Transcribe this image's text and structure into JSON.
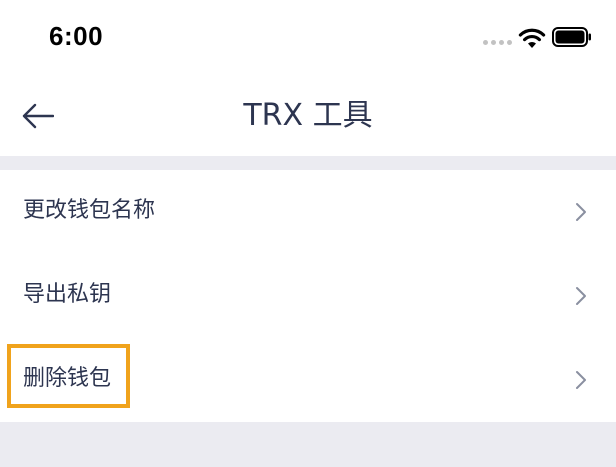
{
  "status_bar": {
    "time": "6:00",
    "icons": [
      "signal-dots-icon",
      "wifi-icon",
      "battery-icon"
    ]
  },
  "nav": {
    "back_icon": "arrow-left-icon",
    "title": "TRX 工具"
  },
  "menu": {
    "items": [
      {
        "label": "更改钱包名称",
        "icon": "chevron-right-icon"
      },
      {
        "label": "导出私钥",
        "icon": "chevron-right-icon"
      },
      {
        "label": "删除钱包",
        "icon": "chevron-right-icon",
        "highlighted": true
      }
    ]
  },
  "colors": {
    "text": "#2d3550",
    "background": "#ebebf1",
    "card": "#ffffff",
    "highlight": "#f0a31c",
    "chevron": "#8a8fa0"
  }
}
